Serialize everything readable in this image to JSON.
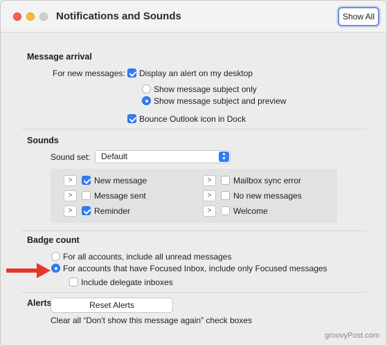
{
  "window": {
    "title": "Notifications and Sounds",
    "show_all_label": "Show All"
  },
  "message_arrival": {
    "title": "Message arrival",
    "for_new_messages_label": "For new messages:",
    "display_alert": {
      "label": "Display an alert on my desktop",
      "checked": true
    },
    "subject_only": {
      "label": "Show message subject only",
      "selected": false
    },
    "subject_preview": {
      "label": "Show message subject and preview",
      "selected": true
    },
    "bounce_icon": {
      "label": "Bounce Outlook icon in Dock",
      "checked": true
    }
  },
  "sounds": {
    "title": "Sounds",
    "sound_set_label": "Sound set:",
    "sound_set_value": "Default",
    "items": [
      {
        "label": "New message",
        "checked": true
      },
      {
        "label": "Message sent",
        "checked": false
      },
      {
        "label": "Reminder",
        "checked": true
      },
      {
        "label": "Mailbox sync error",
        "checked": false
      },
      {
        "label": "No new messages",
        "checked": false
      },
      {
        "label": "Welcome",
        "checked": false
      }
    ]
  },
  "badge_count": {
    "title": "Badge count",
    "all_accounts": {
      "label": "For all accounts, include all unread messages",
      "selected": false
    },
    "focused_accounts": {
      "label": "For accounts that have Focused Inbox, include only Focused messages",
      "selected": true
    },
    "delegate": {
      "label": "Include delegate inboxes",
      "checked": false
    }
  },
  "alerts": {
    "title": "Alerts",
    "description": "Clear all “Don't show this message again” check boxes",
    "reset_label": "Reset Alerts"
  },
  "watermark": "groovyPost.com",
  "colors": {
    "accent": "#2f7cf6",
    "arrow": "#e8352b",
    "focus_ring": "#6a8fd8"
  }
}
